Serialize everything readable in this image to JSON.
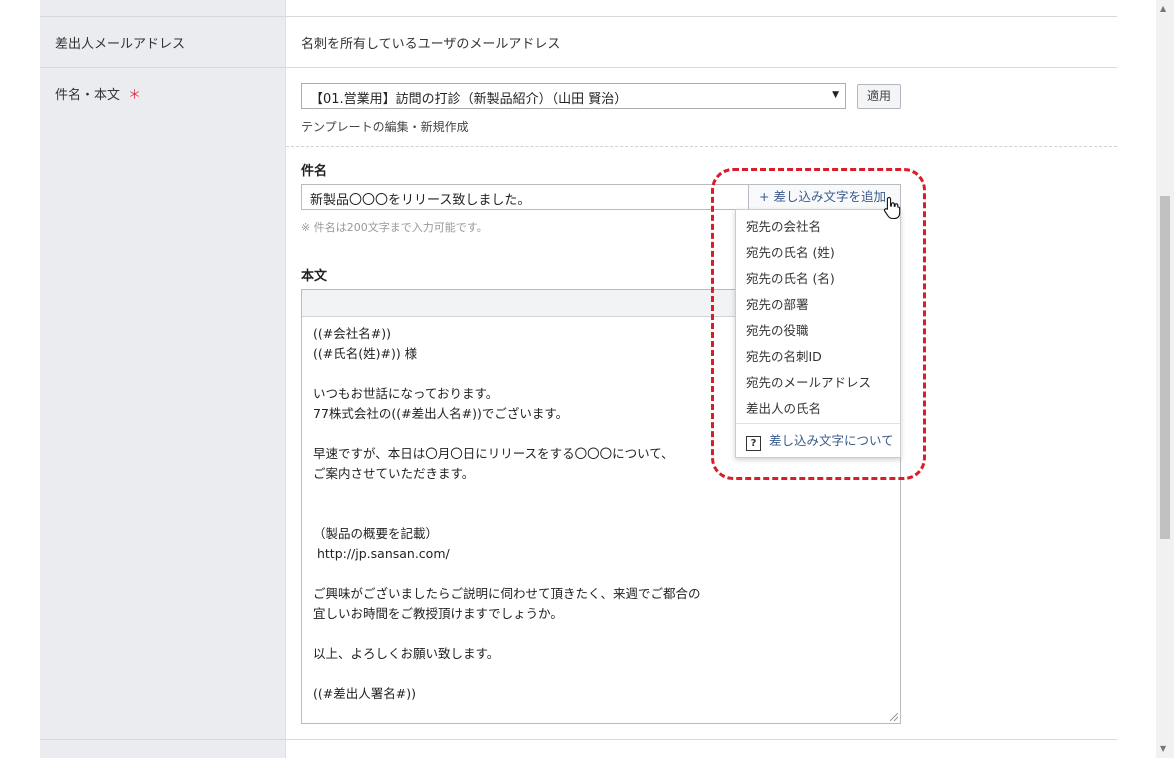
{
  "rows": {
    "sender_email": {
      "label": "差出人メールアドレス",
      "value": "名刺を所有しているユーザのメールアドレス"
    },
    "subject_body": {
      "label": "件名・本文",
      "required_mark": "＊"
    }
  },
  "template": {
    "selected": "【01.営業用】訪問の打診（新製品紹介）（山田 賢治）",
    "apply_label": "適用",
    "edit_link": "テンプレートの編集・新規作成"
  },
  "subject": {
    "label": "件名",
    "value": "新製品〇〇〇をリリース致しました。",
    "add_variable_label": "+ 差し込み文字を追加",
    "note": "※ 件名は200文字まで入力可能です。"
  },
  "body": {
    "label": "本文",
    "text": "((#会社名#))\n((#氏名(姓)#)) 様\n\nいつもお世話になっております。\n77株式会社の((#差出人名#))でございます。\n\n早速ですが、本日は〇月〇日にリリースをする〇〇〇について、\nご案内させていただきます。\n\n\n（製品の概要を記載）\n http://jp.sansan.com/\n\nご興味がございましたらご説明に伺わせて頂きたく、来週でご都合の\n宜しいお時間をご教授頂けますでしょうか。\n\n以上、よろしくお願い致します。\n\n((#差出人署名#))"
  },
  "variable_menu": {
    "items": [
      "宛先の会社名",
      "宛先の氏名 (姓)",
      "宛先の氏名 (名)",
      "宛先の部署",
      "宛先の役職",
      "宛先の名刺ID",
      "宛先のメールアドレス",
      "差出人の氏名"
    ],
    "help_label": "差し込み文字について",
    "help_icon": "question-icon"
  },
  "colors": {
    "label_bg": "#eaecf0",
    "required": "#e0334a",
    "highlight": "#d81e2a",
    "link": "#3a5a8a"
  }
}
